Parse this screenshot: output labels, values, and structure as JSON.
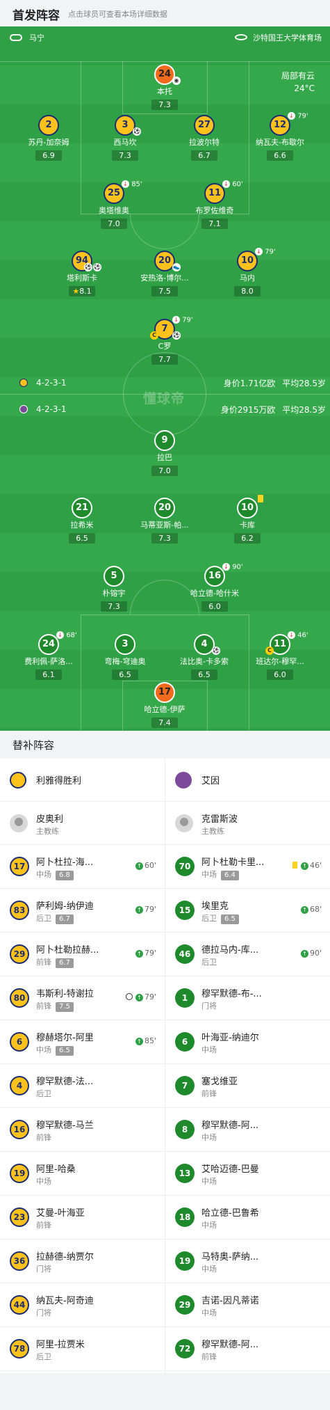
{
  "header": {
    "title": "首发阵容",
    "subtitle": "点击球员可查看本场详细数据"
  },
  "pitch": {
    "coach_label": "马宁",
    "stadium": "沙特国王大学体育场",
    "weather": "局部有云",
    "temperature": "24°C",
    "watermark": "懂球帝",
    "home": {
      "formation": "4-2-3-1",
      "value": "身价1.71亿欧",
      "age": "平均28.5岁",
      "color": "#ffc21c"
    },
    "away": {
      "formation": "4-2-3-1",
      "value": "身价2915万欧",
      "age": "平均28.5岁",
      "color": "#7b4a9a"
    },
    "home_players": [
      {
        "num": "24",
        "name": "本托",
        "rating": "7.3",
        "event": ""
      },
      {
        "num": "2",
        "name": "苏丹-加奈姆",
        "rating": "6.9",
        "event": ""
      },
      {
        "num": "3",
        "name": "西马坎",
        "rating": "7.3",
        "event": ""
      },
      {
        "num": "27",
        "name": "拉波尔特",
        "rating": "6.7",
        "event": ""
      },
      {
        "num": "12",
        "name": "纳瓦夫-布歇尔",
        "rating": "6.6",
        "event": "79'"
      },
      {
        "num": "25",
        "name": "奥塔维奥",
        "rating": "7.0",
        "event": "85'"
      },
      {
        "num": "11",
        "name": "布罗佐维奇",
        "rating": "7.1",
        "event": "60'"
      },
      {
        "num": "94",
        "name": "塔利斯卡",
        "rating": "8.1",
        "event": ""
      },
      {
        "num": "20",
        "name": "安热洛-博尔...",
        "rating": "7.5",
        "event": ""
      },
      {
        "num": "10",
        "name": "马内",
        "rating": "8.0",
        "event": "79'"
      },
      {
        "num": "7",
        "name": "C罗",
        "rating": "7.7",
        "event": "79'"
      }
    ],
    "away_players": [
      {
        "num": "9",
        "name": "拉巴",
        "rating": "7.0",
        "event": ""
      },
      {
        "num": "21",
        "name": "拉希米",
        "rating": "6.5",
        "event": ""
      },
      {
        "num": "20",
        "name": "马蒂亚斯-帕...",
        "rating": "7.3",
        "event": ""
      },
      {
        "num": "10",
        "name": "卡库",
        "rating": "6.2",
        "event": ""
      },
      {
        "num": "5",
        "name": "朴镕宇",
        "rating": "7.3",
        "event": ""
      },
      {
        "num": "16",
        "name": "哈立德-哈什米",
        "rating": "6.0",
        "event": "90'"
      },
      {
        "num": "24",
        "name": "费利佩-萨洛...",
        "rating": "6.1",
        "event": "68'"
      },
      {
        "num": "3",
        "name": "弯梅-穹迪奥",
        "rating": "6.5",
        "event": ""
      },
      {
        "num": "4",
        "name": "法比奥-卡多索",
        "rating": "6.5",
        "event": ""
      },
      {
        "num": "11",
        "name": "班达尔-穆罕...",
        "rating": "6.0",
        "event": "46'"
      },
      {
        "num": "17",
        "name": "哈立德-伊萨",
        "rating": "7.4",
        "event": ""
      }
    ]
  },
  "subs": {
    "title": "替补阵容",
    "home_team": "利雅得胜利",
    "away_team": "艾因",
    "home_coach": {
      "name": "皮奥利",
      "role": "主教练"
    },
    "away_coach": {
      "name": "克雷斯波",
      "role": "主教练"
    },
    "home": [
      {
        "num": "17",
        "name": "阿卜杜拉-海...",
        "pos": "中场",
        "rating": "6.8",
        "minute": "60'"
      },
      {
        "num": "83",
        "name": "萨利姆-纳伊迪",
        "pos": "后卫",
        "rating": "6.7",
        "minute": "79'"
      },
      {
        "num": "29",
        "name": "阿卜杜勒拉赫...",
        "pos": "前锋",
        "rating": "6.7",
        "minute": "79'"
      },
      {
        "num": "80",
        "name": "韦斯利-特谢拉",
        "pos": "前锋",
        "rating": "7.5",
        "minute": "79'"
      },
      {
        "num": "6",
        "name": "穆赫塔尔-阿里",
        "pos": "中场",
        "rating": "6.5",
        "minute": "85'"
      },
      {
        "num": "4",
        "name": "穆罕默德-法...",
        "pos": "后卫",
        "rating": "",
        "minute": ""
      },
      {
        "num": "16",
        "name": "穆罕默德-马兰",
        "pos": "前锋",
        "rating": "",
        "minute": ""
      },
      {
        "num": "19",
        "name": "阿里-哈桑",
        "pos": "中场",
        "rating": "",
        "minute": ""
      },
      {
        "num": "23",
        "name": "艾曼-叶海亚",
        "pos": "前锋",
        "rating": "",
        "minute": ""
      },
      {
        "num": "36",
        "name": "拉赫德-纳贾尔",
        "pos": "门将",
        "rating": "",
        "minute": ""
      },
      {
        "num": "44",
        "name": "纳瓦夫-阿奇迪",
        "pos": "门将",
        "rating": "",
        "minute": ""
      },
      {
        "num": "78",
        "name": "阿里-拉贾米",
        "pos": "后卫",
        "rating": "",
        "minute": ""
      }
    ],
    "away": [
      {
        "num": "70",
        "name": "阿卜杜勒卡里...",
        "pos": "中场",
        "rating": "6.4",
        "minute": "46'"
      },
      {
        "num": "15",
        "name": "埃里克",
        "pos": "后卫",
        "rating": "6.5",
        "minute": "68'"
      },
      {
        "num": "46",
        "name": "德拉马内-库...",
        "pos": "后卫",
        "rating": "",
        "minute": "90'"
      },
      {
        "num": "1",
        "name": "穆罕默德-布-...",
        "pos": "门将",
        "rating": "",
        "minute": ""
      },
      {
        "num": "6",
        "name": "叶海亚-纳迪尔",
        "pos": "中场",
        "rating": "",
        "minute": ""
      },
      {
        "num": "7",
        "name": "塞戈维亚",
        "pos": "前锋",
        "rating": "",
        "minute": ""
      },
      {
        "num": "8",
        "name": "穆罕默德-阿...",
        "pos": "中场",
        "rating": "",
        "minute": ""
      },
      {
        "num": "13",
        "name": "艾哈迈德-巴曼",
        "pos": "中场",
        "rating": "",
        "minute": ""
      },
      {
        "num": "18",
        "name": "哈立德-巴鲁希",
        "pos": "中场",
        "rating": "",
        "minute": ""
      },
      {
        "num": "19",
        "name": "马特奥-萨纳...",
        "pos": "中场",
        "rating": "",
        "minute": ""
      },
      {
        "num": "29",
        "name": "吉诺-因凡蒂诺",
        "pos": "中场",
        "rating": "",
        "minute": ""
      },
      {
        "num": "72",
        "name": "穆罕默德-阿...",
        "pos": "前锋",
        "rating": "",
        "minute": ""
      }
    ]
  }
}
